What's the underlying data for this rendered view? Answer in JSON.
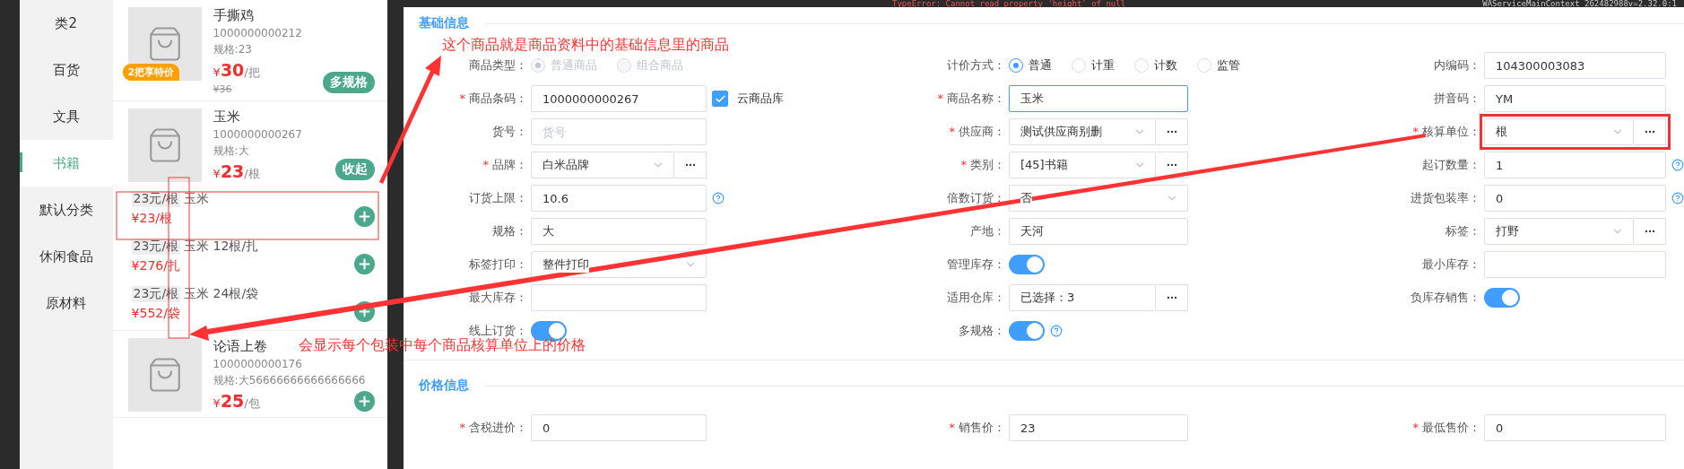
{
  "devtools": {
    "error": "TypeError: Cannot read property 'height' of null",
    "source": "WAServiceMainContext 262482988v=2.32.0:1"
  },
  "categories": [
    {
      "label": "类2",
      "selected": false
    },
    {
      "label": "百货",
      "selected": false
    },
    {
      "label": "文具",
      "selected": false
    },
    {
      "label": "书籍",
      "selected": true
    },
    {
      "label": "默认分类",
      "selected": false
    },
    {
      "label": "休闲食品",
      "selected": false
    },
    {
      "label": "原材料",
      "selected": false
    }
  ],
  "products": [
    {
      "name": "手撕鸡",
      "code": "1000000000212",
      "spec": "规格:23",
      "currency": "¥",
      "price": "30",
      "unit": "/把",
      "old_price": "¥36",
      "promo": "2把享特价",
      "action": {
        "kind": "tag",
        "label": "多规格"
      }
    },
    {
      "name": "玉米",
      "code": "1000000000267",
      "spec": "规格:大",
      "currency": "¥",
      "price": "23",
      "unit": "/根",
      "action": {
        "kind": "tag",
        "label": "收起"
      },
      "packages": [
        {
          "unit_price": "23元/根",
          "title": "玉米",
          "currency": "¥",
          "price": "23",
          "unit": "/根"
        },
        {
          "unit_price": "23元/根",
          "title": "玉米 12根/扎",
          "currency": "¥",
          "price": "276",
          "unit": "/扎"
        },
        {
          "unit_price": "23元/根",
          "title": "玉米 24根/袋",
          "currency": "¥",
          "price": "552",
          "unit": "/袋"
        }
      ]
    },
    {
      "name": "论语上卷",
      "code": "1000000000176",
      "spec": "规格:大56666666666666666",
      "currency": "¥",
      "price": "25",
      "unit": "/包",
      "action": {
        "kind": "add"
      }
    }
  ],
  "form": {
    "sections": [
      {
        "title": "基础信息",
        "columns": [
          [
            {
              "label": "商品类型：",
              "kind": "radio",
              "disabled": true,
              "options": [
                {
                  "label": "普通商品",
                  "selected": true
                },
                {
                  "label": "组合商品",
                  "selected": false
                }
              ]
            },
            {
              "label": "商品条码：",
              "kind": "input_check",
              "marker": "*",
              "value": "1000000000267",
              "check": {
                "label": "云商品库",
                "checked": true
              }
            },
            {
              "label": "货号：",
              "kind": "input",
              "placeholder": "货号"
            },
            {
              "label": "品牌：",
              "kind": "select_more",
              "marker": "*",
              "value": "白米品牌"
            },
            {
              "label": "订货上限：",
              "kind": "input",
              "value": "10.6",
              "help": true
            },
            {
              "label": "规格：",
              "kind": "input",
              "value": "大"
            },
            {
              "label": "标签打印：",
              "kind": "select",
              "value": "整件打印"
            },
            {
              "label": "最大库存：",
              "kind": "input"
            },
            {
              "label": "线上订货：",
              "kind": "switch",
              "on": true
            }
          ],
          [
            {
              "label": "计价方式：",
              "kind": "radio",
              "disabled": false,
              "options": [
                {
                  "label": "普通",
                  "selected": true
                },
                {
                  "label": "计重",
                  "selected": false
                },
                {
                  "label": "计数",
                  "selected": false
                },
                {
                  "label": "监管",
                  "selected": false
                }
              ]
            },
            {
              "label": "商品名称：",
              "kind": "input",
              "marker": "*",
              "value": "玉米",
              "focused": true
            },
            {
              "label": "供应商：",
              "kind": "select_more",
              "marker": "*",
              "value": "测试供应商别删"
            },
            {
              "label": "类别：",
              "kind": "select_more",
              "marker": "*",
              "value": "[45]书籍"
            },
            {
              "label": "倍数订货：",
              "kind": "select",
              "value": "否"
            },
            {
              "label": "产地：",
              "kind": "input",
              "value": "天河"
            },
            {
              "label": "管理库存：",
              "kind": "switch",
              "on": true
            },
            {
              "label": "适用仓库：",
              "kind": "input_more",
              "value": "已选择：3"
            },
            {
              "label": "多规格：",
              "kind": "switch",
              "on": true,
              "help": true
            }
          ],
          [
            {
              "label": "内编码：",
              "kind": "input",
              "value": "104300003083"
            },
            {
              "label": "拼音码：",
              "kind": "input",
              "value": "YM"
            },
            {
              "label": "核算单位：",
              "kind": "select_more",
              "marker": "*",
              "value": "根",
              "annotated": true
            },
            {
              "label": "起订数量：",
              "kind": "input",
              "value": "1",
              "help": true
            },
            {
              "label": "进货包装率：",
              "kind": "input",
              "value": "0",
              "help": true
            },
            {
              "label": "标签：",
              "kind": "select_more",
              "value": "打野"
            },
            {
              "label": "最小库存：",
              "kind": "input"
            },
            {
              "label": "负库存销售：",
              "kind": "switch",
              "on": true
            }
          ]
        ]
      },
      {
        "title": "价格信息",
        "columns": [
          [
            {
              "label": "含税进价：",
              "kind": "input",
              "marker": "*",
              "value": "0"
            }
          ],
          [
            {
              "label": "销售价：",
              "kind": "input",
              "marker": "*",
              "value": "23"
            }
          ],
          [
            {
              "label": "最低售价：",
              "kind": "input",
              "marker": "*",
              "value": "0"
            }
          ]
        ]
      }
    ]
  },
  "annotations": [
    {
      "text": "这个商品就是商品资料中的基础信息里的商品"
    },
    {
      "text": "会显示每个包装中每个商品核算单位上的价格"
    }
  ]
}
